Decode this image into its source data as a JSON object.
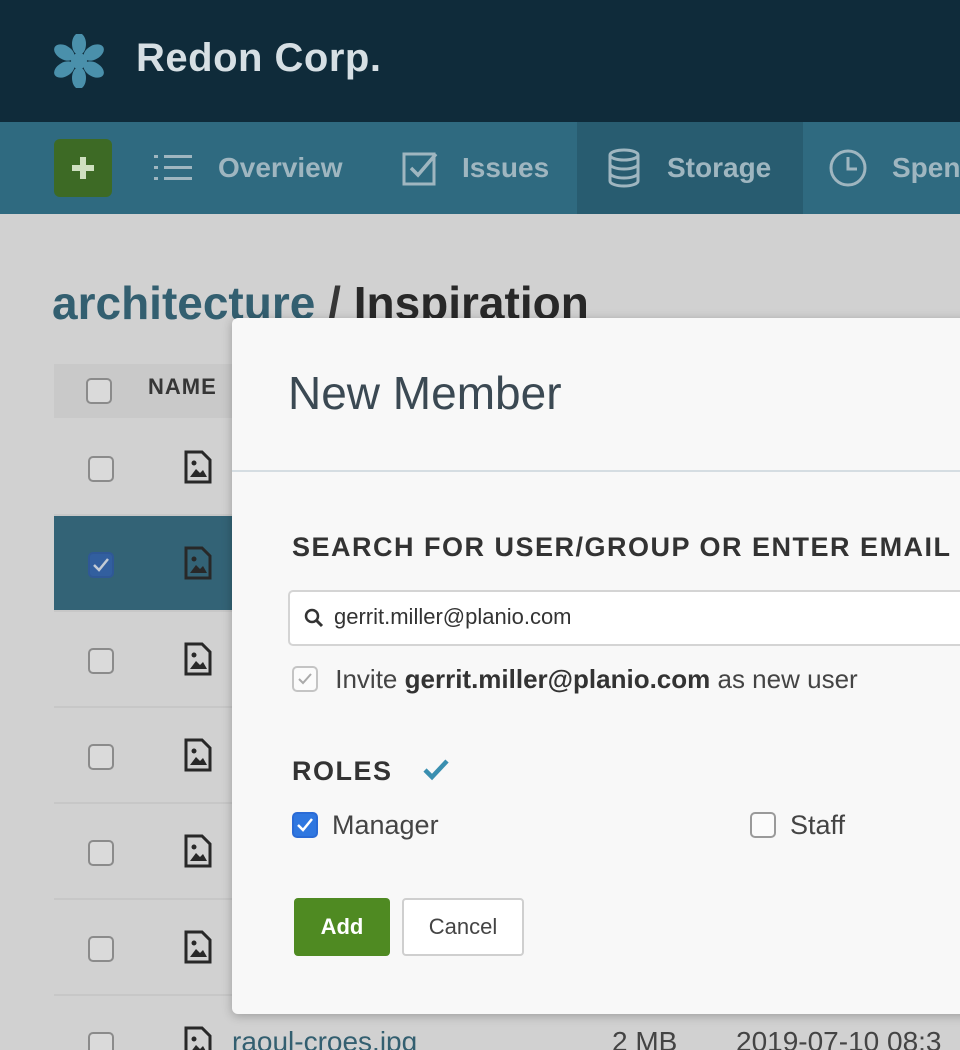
{
  "header": {
    "brand": "Redon Corp.",
    "logo_icon": "asterisk-logo-icon"
  },
  "nav": {
    "add_icon": "plus-icon",
    "items": [
      {
        "label": "Overview",
        "icon": "list-icon",
        "active": false
      },
      {
        "label": "Issues",
        "icon": "checkbox-icon",
        "active": false
      },
      {
        "label": "Storage",
        "icon": "database-icon",
        "active": true
      },
      {
        "label": "Spen",
        "icon": "clock-icon",
        "active": false
      }
    ]
  },
  "page": {
    "breadcrumb": {
      "parent": "architecture",
      "separator": " / ",
      "current": "Inspiration"
    },
    "table": {
      "header_name": "NAME",
      "last_row": {
        "name": "raoul-croes.jpg",
        "size": "2 MB",
        "date": "2019-07-10 08:3"
      }
    }
  },
  "modal": {
    "title": "New Member",
    "search_label": "SEARCH FOR USER/GROUP OR ENTER EMAIL",
    "search_value": "gerrit.miller@planio.com",
    "invite": {
      "prefix": "Invite",
      "email": "gerrit.miller@planio.com",
      "suffix": "as new user"
    },
    "roles_label": "ROLES",
    "roles": [
      {
        "label": "Manager",
        "checked": true
      },
      {
        "label": "Staff",
        "checked": false
      }
    ],
    "add_label": "Add",
    "cancel_label": "Cancel"
  },
  "colors": {
    "header_bg": "#0f2b3a",
    "nav_bg": "#2f6a80",
    "accent_green": "#4f8a22",
    "checkbox_blue": "#2f77e0",
    "link": "#2f6479"
  }
}
